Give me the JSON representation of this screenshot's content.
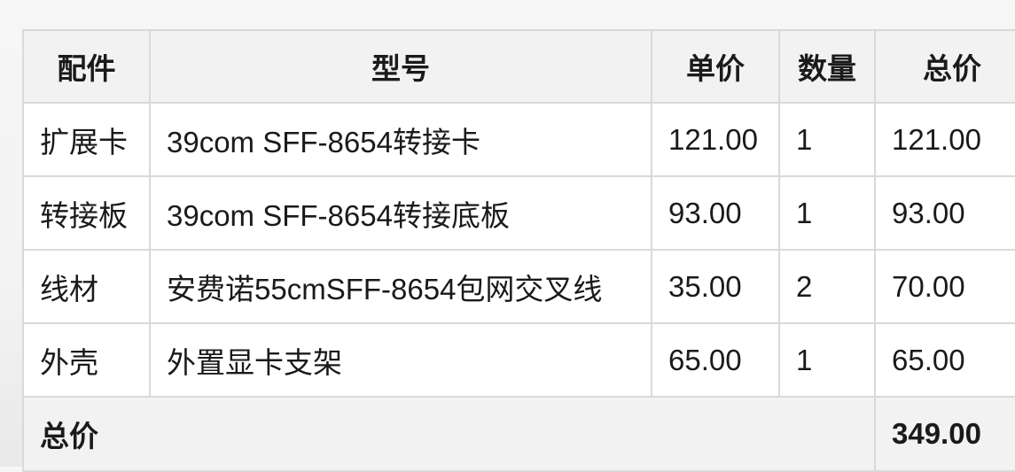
{
  "table": {
    "headers": [
      "配件",
      "型号",
      "单价",
      "数量",
      "总价"
    ],
    "rows": [
      [
        "扩展卡",
        "39com SFF-8654转接卡",
        "121.00",
        "1",
        "121.00"
      ],
      [
        "转接板",
        "39com SFF-8654转接底板",
        "93.00",
        "1",
        "93.00"
      ],
      [
        "线材",
        "安费诺55cmSFF-8654包网交叉线",
        "35.00",
        "2",
        "70.00"
      ],
      [
        "外壳",
        "外置显卡支架",
        "65.00",
        "1",
        "65.00"
      ]
    ],
    "footer": {
      "label": "总价",
      "value": "349.00"
    }
  }
}
